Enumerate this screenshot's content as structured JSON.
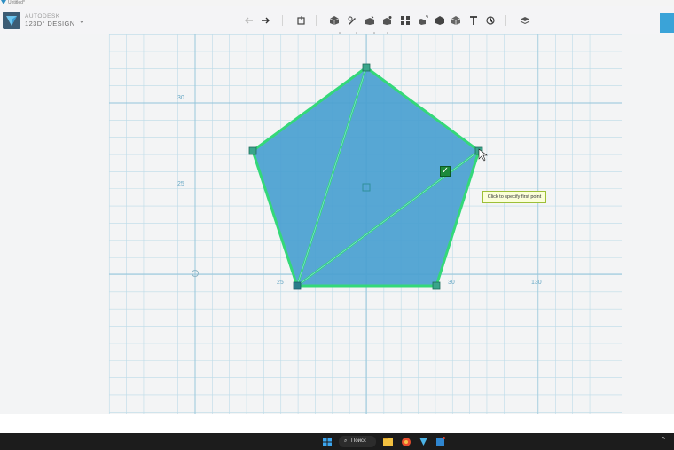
{
  "window": {
    "title": "Untitled*"
  },
  "brand": {
    "line1": "AUTODESK",
    "line2": "123D° DESIGN"
  },
  "toolbar": {
    "items": [
      {
        "name": "undo-icon"
      },
      {
        "name": "redo-icon"
      },
      {
        "name": "transform-icon"
      },
      {
        "name": "primitives-icon"
      },
      {
        "name": "sketch-icon"
      },
      {
        "name": "construct-icon"
      },
      {
        "name": "modify-icon"
      },
      {
        "name": "pattern-icon"
      },
      {
        "name": "group-icon"
      },
      {
        "name": "combine-icon"
      },
      {
        "name": "measure-icon"
      },
      {
        "name": "text-icon"
      },
      {
        "name": "snap-icon"
      },
      {
        "name": "material-icon"
      }
    ]
  },
  "canvas": {
    "axis_labels": {
      "y_top": "30",
      "y_mid": "25",
      "x_left": "25",
      "x_mid": "30",
      "x_right": "130"
    },
    "tooltip": "Click to specify first point",
    "check_mark": "✓",
    "colors": {
      "grid": "#a9cfe0",
      "grid_major": "#8fc1d8",
      "fill": "#4a9fd0",
      "outline": "#34d879",
      "background": "#f3f4f5"
    }
  },
  "taskbar": {
    "search_label": "Поиск",
    "tray_chevron": "^",
    "items": [
      {
        "name": "windows-start-icon"
      },
      {
        "name": "search-icon"
      },
      {
        "name": "file-explorer-icon"
      },
      {
        "name": "browser-icon"
      },
      {
        "name": "app-123d-icon"
      },
      {
        "name": "store-icon"
      }
    ]
  }
}
